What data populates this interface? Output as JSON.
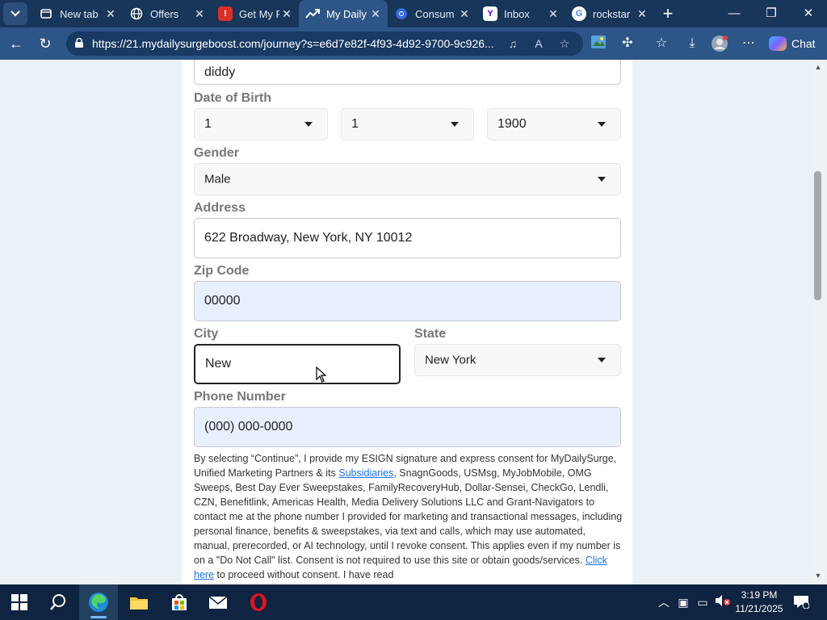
{
  "browser": {
    "tabs": [
      {
        "title": "New tab",
        "icon": "newtab-icon",
        "color": "#3a6ea5"
      },
      {
        "title": "Offers",
        "icon": "globe-icon",
        "color": "#3a6ea5"
      },
      {
        "title": "Get My F",
        "icon": "red-square-icon",
        "color": "#d93025"
      },
      {
        "title": "My Daily",
        "icon": "trend-arrow-icon",
        "color": "#2d5587",
        "active": true
      },
      {
        "title": "Consum",
        "icon": "chrome-icon",
        "color": "#3367d6"
      },
      {
        "title": "Inbox",
        "icon": "yahoo-icon",
        "color": "#5f01d1"
      },
      {
        "title": "rockstar",
        "icon": "google-icon",
        "color": "#ffffff"
      }
    ],
    "new_tab_label": "+",
    "url": "https://21.mydailysurgeboost.com/journey?s=e6d7e82f-4f93-4d92-9700-9c926...",
    "chat_label": "Chat"
  },
  "form": {
    "name_value": "diddy",
    "dob": {
      "label": "Date of Birth",
      "month": "1",
      "day": "1",
      "year": "1900"
    },
    "gender": {
      "label": "Gender",
      "value": "Male"
    },
    "address": {
      "label": "Address",
      "value": "622 Broadway, New York, NY 10012"
    },
    "zip": {
      "label": "Zip Code",
      "value": "00000"
    },
    "city": {
      "label": "City",
      "value": "New"
    },
    "state": {
      "label": "State",
      "value": "New York"
    },
    "phone": {
      "label": "Phone Number",
      "value": "(000) 000-0000"
    },
    "consent": {
      "part1": "By selecting “Continue”, I provide my ESIGN signature and express consent for MyDailySurge, Unified Marketing Partners & its ",
      "link1": "Subsidiaries",
      "part2": ", SnagnGoods, USMsg, MyJobMobile, OMG Sweeps, Best Day Ever Sweepstakes, FamilyRecoveryHub, Dollar-Sensei, CheckGo, Lendli, CZN, Benefitlink, Americas Health, Media Delivery Solutions LLC and Grant-Navigators to contact me at the phone number I provided for marketing and transactional messages, including personal finance, benefits & sweepstakes, via text and calls, which may use automated, manual, prerecorded, or AI technology, until I revoke consent. This applies even if my number is on a \"Do Not Call\" list. Consent is not required to use this site or obtain goods/services. ",
      "link2": "Click here",
      "part3": " to proceed without consent. I have read"
    }
  },
  "taskbar": {
    "time": "3:19 PM",
    "date": "11/21/2025"
  }
}
